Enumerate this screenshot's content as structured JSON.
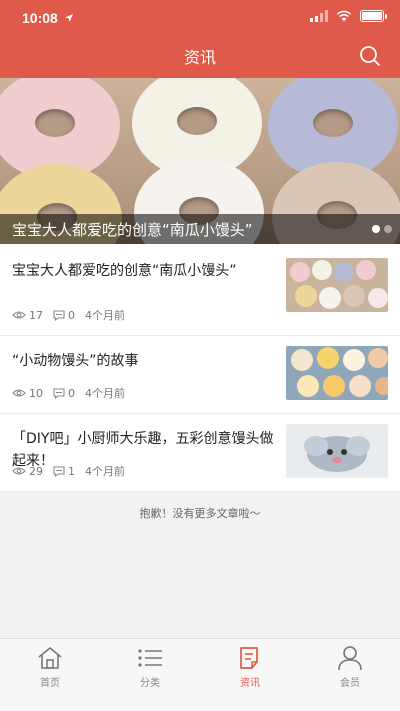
{
  "theme": {
    "accent": "#e05a4b"
  },
  "status_bar": {
    "time": "10:08",
    "battery": 1.0,
    "signal_bars": 2
  },
  "header": {
    "title": "资讯"
  },
  "banner": {
    "caption": "宝宝大人都爱吃的创意“南瓜小馒头”",
    "slide_count": 2,
    "active_slide": 1
  },
  "articles": [
    {
      "title": "宝宝大人都爱吃的创意“南瓜小馒头”",
      "views": "17",
      "comments": "0",
      "time": "4个月前"
    },
    {
      "title": "“小动物馒头”的故事",
      "views": "10",
      "comments": "0",
      "time": "4个月前"
    },
    {
      "title": "「DIY吧」小厨师大乐趣，五彩创意馒头做起来！",
      "views": "29",
      "comments": "1",
      "time": "4个月前"
    }
  ],
  "footer_note": "抱歉！没有更多文章啦～",
  "tabbar": {
    "active": "资讯",
    "tabs": [
      {
        "label": "首页",
        "icon": "home-icon"
      },
      {
        "label": "分类",
        "icon": "list-icon"
      },
      {
        "label": "资讯",
        "icon": "article-icon"
      },
      {
        "label": "会员",
        "icon": "user-icon"
      }
    ]
  }
}
